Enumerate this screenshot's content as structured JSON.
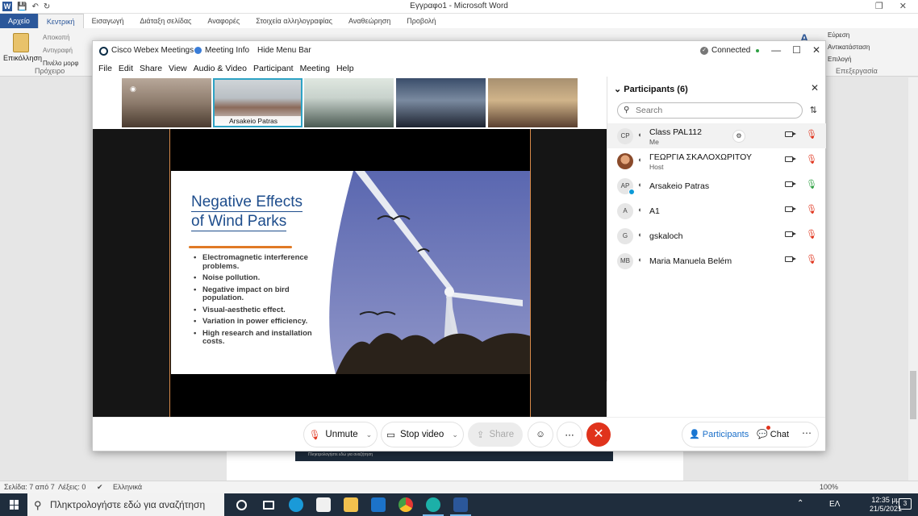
{
  "word": {
    "title": "Εγγραφο1  -  Microsoft Word",
    "tabs": [
      {
        "label": "Αρχείο",
        "key": "file"
      },
      {
        "label": "Κεντρική",
        "key": "home"
      },
      {
        "label": "Εισαγωγή",
        "key": "insert"
      },
      {
        "label": "Διάταξη σελίδας",
        "key": "layout"
      },
      {
        "label": "Αναφορές",
        "key": "refs"
      },
      {
        "label": "Στοιχεία αλληλογραφίας",
        "key": "mail"
      },
      {
        "label": "Αναθεώρηση",
        "key": "review"
      },
      {
        "label": "Προβολή",
        "key": "view"
      }
    ],
    "clipboard": {
      "paste": "Επικόλληση",
      "cut": "Αποκοπή",
      "copy": "Αντιγραφή",
      "format_painter": "Πινέλο μορφ",
      "group": "Πρόχειρο"
    },
    "editing": {
      "find": "Εύρεση",
      "replace": "Αντικατάσταση",
      "select": "Επιλογή",
      "group": "Επεξεργασία"
    },
    "status": {
      "page": "Σελίδα: 7 από 7",
      "words": "Λέξεις: 0",
      "language": "Ελληνικά",
      "zoom": "100%"
    }
  },
  "taskbar": {
    "search_placeholder": "Πληκτρολογήστε εδώ για αναζήτηση",
    "language": "ΕΛ",
    "time": "12:35 μμ",
    "date": "21/5/2021",
    "notifications": "3"
  },
  "webex": {
    "app_title": "Cisco Webex Meetings",
    "meeting_info": "Meeting Info",
    "hide_menu": "Hide Menu Bar",
    "connection": "Connected",
    "menu": [
      "File",
      "Edit",
      "Share",
      "View",
      "Audio & Video",
      "Participant",
      "Meeting",
      "Help"
    ],
    "thumbnails": [
      {
        "name": "",
        "selected": false
      },
      {
        "name": "Arsakeio Patras",
        "selected": true
      },
      {
        "name": "",
        "selected": false
      },
      {
        "name": "",
        "selected": false
      },
      {
        "name": "",
        "selected": false
      }
    ],
    "slide": {
      "title_line1": "Negative Effects",
      "title_line2": "of Wind Parks",
      "bullets": [
        "Electromagnetic interference problems.",
        "Noise pollution.",
        "Negative impact on bird population.",
        "Visual-aesthetic effect.",
        "Variation in power efficiency.",
        "High research and installation costs."
      ]
    },
    "controls": {
      "unmute": "Unmute",
      "stop_video": "Stop video",
      "share": "Share",
      "participants": "Participants",
      "chat": "Chat"
    },
    "participants_panel": {
      "header": "Participants (6)",
      "search_placeholder": "Search",
      "list": [
        {
          "initials": "CP",
          "name": "Class PAL112",
          "role": "Me",
          "mic": "muted",
          "photo": false
        },
        {
          "initials": "",
          "name": "ΓΕΩΡΓΙΑ ΣΚΑΛΟΧΩΡΙΤΟΥ",
          "role": "Host",
          "mic": "muted",
          "photo": true
        },
        {
          "initials": "AP",
          "name": "Arsakeio Patras",
          "role": "",
          "mic": "on",
          "photo": false
        },
        {
          "initials": "A",
          "name": "A1",
          "role": "",
          "mic": "muted",
          "photo": false
        },
        {
          "initials": "G",
          "name": "gskaloch",
          "role": "",
          "mic": "muted",
          "photo": false
        },
        {
          "initials": "MB",
          "name": "Maria Manuela Belém",
          "role": "",
          "mic": "muted",
          "photo": false
        }
      ]
    }
  },
  "colors": {
    "word_blue": "#2b579a",
    "webex_end_red": "#e0331c",
    "webex_link_blue": "#1a6fc9",
    "slide_title_blue": "#1e4d8c",
    "slide_accent_orange": "#e07a26"
  }
}
